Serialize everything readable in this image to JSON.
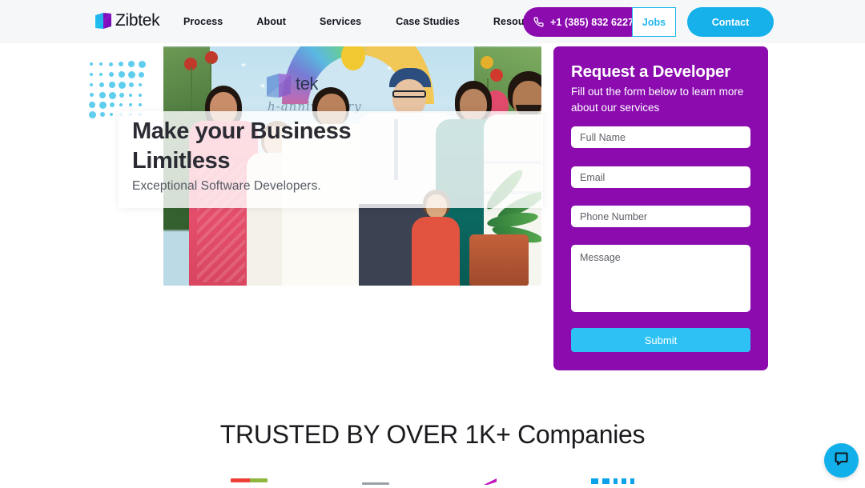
{
  "header": {
    "logo_text": "Zibtek",
    "logo_icon": "zibtek-butterfly-logo",
    "nav": [
      {
        "label": "Process"
      },
      {
        "label": "About"
      },
      {
        "label": "Services"
      },
      {
        "label": "Case Studies"
      },
      {
        "label": "Resources"
      }
    ],
    "phone_button": {
      "label": "+1 (385) 832 6227",
      "icon": "phone-icon",
      "color": "#8b0baf"
    },
    "jobs_button": {
      "label": "Jobs",
      "color": "#1fb6ef"
    },
    "contact_button": {
      "label": "Contact",
      "color": "#16b1ea"
    },
    "background": "#f6f7f9"
  },
  "hero": {
    "heading": "Make your Business Limitless",
    "subheading": "Exceptional Software Developers.",
    "photo_alt": "Group of people at Zibtek anniversary event",
    "photo_banner_text": "Zibtek",
    "dots_color": "#5fcdee"
  },
  "form": {
    "title": "Request a Developer",
    "description": "Fill out the form below to learn more about our services",
    "panel_color": "#8b0baf",
    "fields": [
      {
        "name": "full_name",
        "placeholder": "Full Name",
        "value": ""
      },
      {
        "name": "email",
        "placeholder": "Email",
        "value": ""
      },
      {
        "name": "phone",
        "placeholder": "Phone Number",
        "value": ""
      },
      {
        "name": "message",
        "placeholder": "Message",
        "value": ""
      }
    ],
    "submit_label": "Submit",
    "submit_color": "#2ec2f4"
  },
  "trusted": {
    "heading": "TRUSTED BY OVER 1K+ Companies"
  },
  "chat": {
    "icon": "chat-bubble-icon",
    "color": "#12b0ea"
  }
}
